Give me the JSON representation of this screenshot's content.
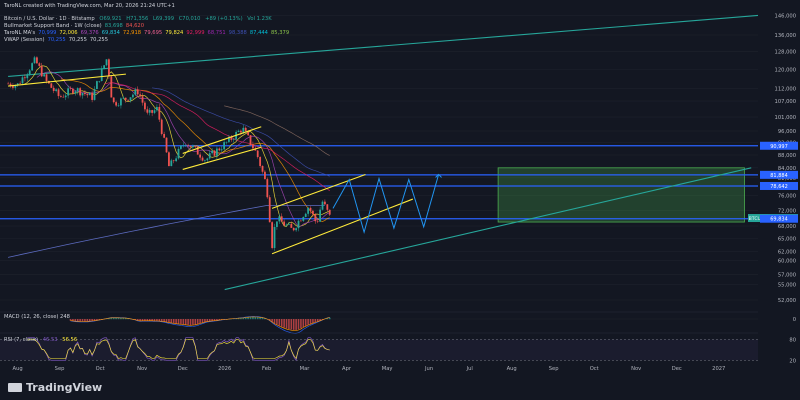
{
  "header": {
    "author_line": "TaroNL created with TradingView.com, Mar 20, 2026 21:24 UTC+1",
    "symbol_line": {
      "label": "Bitcoin / U.S. Dollar · 1D · Bitstamp",
      "o": "O69,921",
      "h": "H71,356",
      "l": "L69,399",
      "c": "C70,010",
      "change": "+89 (+0.13%)",
      "vol": "Vol 1.23K"
    },
    "indicator_lines": [
      {
        "label": "Bullmarket Support Band · 1W (close)",
        "values": [
          "83,698",
          "84,620"
        ],
        "colors": [
          "#26a69a",
          "#ef5350"
        ]
      },
      {
        "label": "TaroNL MA's",
        "values": [
          "70,999",
          "72,006",
          "69,376",
          "69,834",
          "72,918",
          "79,695",
          "79,824",
          "92,999",
          "68,751",
          "98,388",
          "87,444",
          "85,379"
        ],
        "colors": [
          "#2962ff",
          "#ffeb3b",
          "#ab47bc",
          "#26c6da",
          "#ff9800",
          "#f06292",
          "#ffeb3b",
          "#e91e63",
          "#9c27b0",
          "#3f51b5",
          "#00bcd4",
          "#8bc34a"
        ]
      },
      {
        "label": "VWAP (Session)",
        "values": [
          "70,255",
          "70,255",
          "70,255"
        ],
        "colors": [
          "#2962ff",
          "#d1d4dc",
          "#d1d4dc"
        ]
      }
    ],
    "macd_label": "MACD (12, 26, close) 248",
    "rsi_label": "RSI (7, close)",
    "rsi_values": [
      "46.53",
      "56.56"
    ]
  },
  "logo_text": "TradingView",
  "colors": {
    "background": "#131722",
    "up": "#26a69a",
    "down": "#ef5350",
    "blue_line": "#2962ff",
    "projection": "#2196f3",
    "trendline": "#ffeb3b",
    "green_line": "#26a69a",
    "box_fill": "#4caf50",
    "grid": "#1e222d",
    "text": "#b2b5be"
  },
  "chart_data": {
    "type": "candlestick",
    "title": "Bitcoin / U.S. Dollar · 1D · Bitstamp",
    "x_ticks": [
      "Aug",
      "Sep",
      "Oct",
      "Nov",
      "Dec",
      "2026",
      "Feb",
      "Mar",
      "Apr",
      "May",
      "Jun",
      "Jul",
      "Aug",
      "Sep",
      "Oct",
      "Nov",
      "Dec",
      "2027"
    ],
    "y_ticks": [
      146000,
      136000,
      128000,
      120000,
      112000,
      107000,
      101000,
      96000,
      92000,
      88000,
      84000,
      81000,
      76000,
      72000,
      68000,
      65000,
      62000,
      60000,
      57000,
      55000,
      52000
    ],
    "ylim": [
      51000,
      150000
    ],
    "price_labels": [
      {
        "value": 90997,
        "text": "90,997",
        "color": "#2962ff"
      },
      {
        "value": 81884,
        "text": "81,884",
        "color": "#2962ff"
      },
      {
        "value": 78642,
        "text": "78,642",
        "color": "#2962ff"
      },
      {
        "value": 70010,
        "text": "70,010",
        "color": "#26a69a",
        "tag": "BTCUSD"
      },
      {
        "value": 69834,
        "text": "69,834",
        "color": "#2962ff"
      }
    ],
    "horizontal_levels": [
      90997,
      81884,
      78642,
      69834
    ],
    "price_path": [
      [
        "2025-07-25",
        114000
      ],
      [
        "2025-08-01",
        113500
      ],
      [
        "2025-08-14",
        124000
      ],
      [
        "2025-08-22",
        115000
      ],
      [
        "2025-09-01",
        108500
      ],
      [
        "2025-09-12",
        112000
      ],
      [
        "2025-09-25",
        108500
      ],
      [
        "2025-10-06",
        125000
      ],
      [
        "2025-10-10",
        106000
      ],
      [
        "2025-10-20",
        108000
      ],
      [
        "2025-10-29",
        111000
      ],
      [
        "2025-11-05",
        101500
      ],
      [
        "2025-11-12",
        104000
      ],
      [
        "2025-11-21",
        84000
      ],
      [
        "2025-12-03",
        92500
      ],
      [
        "2025-12-18",
        86500
      ],
      [
        "2026-01-05",
        93000
      ],
      [
        "2026-01-14",
        97000
      ],
      [
        "2026-01-25",
        88000
      ],
      [
        "2026-02-01",
        78500
      ],
      [
        "2026-02-05",
        63500
      ],
      [
        "2026-02-08",
        70000
      ],
      [
        "2026-02-20",
        67000
      ],
      [
        "2026-03-04",
        73000
      ],
      [
        "2026-03-10",
        68500
      ],
      [
        "2026-03-14",
        74500
      ],
      [
        "2026-03-20",
        70010
      ]
    ],
    "trendlines": [
      {
        "from": [
          "2025-07-25",
          113000
        ],
        "to": [
          "2025-10-20",
          118000
        ],
        "color": "#ffeb3b"
      },
      {
        "from": [
          "2025-12-01",
          88500
        ],
        "to": [
          "2026-01-28",
          97500
        ],
        "color": "#ffeb3b"
      },
      {
        "from": [
          "2025-12-01",
          83500
        ],
        "to": [
          "2026-01-28",
          90500
        ],
        "color": "#ffeb3b"
      },
      {
        "from": [
          "2026-02-05",
          72500
        ],
        "to": [
          "2026-04-15",
          82000
        ],
        "color": "#ffeb3b"
      },
      {
        "from": [
          "2026-02-05",
          61500
        ],
        "to": [
          "2026-05-20",
          75000
        ],
        "color": "#ffeb3b"
      },
      {
        "from": [
          "2025-07-25",
          117000
        ],
        "to": [
          "2027-01-30",
          146000
        ],
        "color": "#26a69a"
      },
      {
        "from": [
          "2026-01-01",
          54000
        ],
        "to": [
          "2027-01-25",
          84000
        ],
        "color": "#26a69a"
      }
    ],
    "projection": [
      [
        "2026-03-22",
        72500
      ],
      [
        "2026-04-03",
        80500
      ],
      [
        "2026-04-14",
        66500
      ],
      [
        "2026-04-25",
        80800
      ],
      [
        "2026-05-06",
        67500
      ],
      [
        "2026-05-17",
        80500
      ],
      [
        "2026-05-28",
        67800
      ],
      [
        "2026-06-08",
        82000
      ]
    ],
    "target_box": {
      "from": [
        "2026-07-22",
        84000
      ],
      "to": [
        "2027-01-20",
        69000
      ]
    },
    "macd": {
      "ylim": [
        -1,
        1
      ],
      "tick": "0"
    },
    "rsi": {
      "ylim": [
        15,
        90
      ],
      "ticks": [
        80,
        20
      ],
      "values": [
        46.53,
        56.56
      ]
    }
  }
}
